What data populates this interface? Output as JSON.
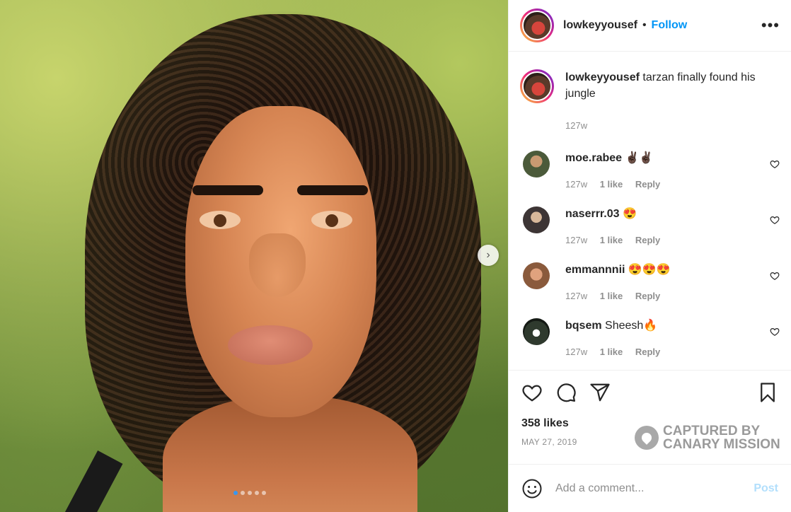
{
  "post": {
    "username": "lowkeyyousef",
    "separator": "•",
    "follow_label": "Follow",
    "more_label": "•••",
    "next_label": "›",
    "carousel": {
      "count": 5,
      "active_index": 0
    }
  },
  "caption": {
    "username": "lowkeyyousef",
    "text": "tarzan finally found his jungle",
    "time": "127w"
  },
  "comments": [
    {
      "username": "moe.rabee",
      "text": "✌🏿✌🏿",
      "time": "127w",
      "likes": "1 like",
      "reply": "Reply",
      "avatar_color": "#4b5a3a"
    },
    {
      "username": "naserrr.03",
      "text": "😍",
      "time": "127w",
      "likes": "1 like",
      "reply": "Reply",
      "avatar_color": "#3d3535"
    },
    {
      "username": "emmannnii",
      "text": "😍😍😍",
      "time": "127w",
      "likes": "1 like",
      "reply": "Reply",
      "avatar_color": "#8a5a3c"
    },
    {
      "username": "bqsem",
      "text": "Sheesh🔥",
      "time": "127w",
      "likes": "1 like",
      "reply": "Reply",
      "avatar_color": "#2f3a2e"
    }
  ],
  "stats": {
    "likes": "358 likes",
    "date": "MAY 27, 2019"
  },
  "watermark": {
    "line1": "CAPTURED BY",
    "line2": "CANARY MISSION"
  },
  "add_comment": {
    "placeholder": "Add a comment...",
    "post_label": "Post"
  },
  "icons": [
    "heart-icon",
    "comment-icon",
    "share-icon",
    "bookmark-icon",
    "emoji-icon",
    "more-icon",
    "chevron-right-icon"
  ]
}
